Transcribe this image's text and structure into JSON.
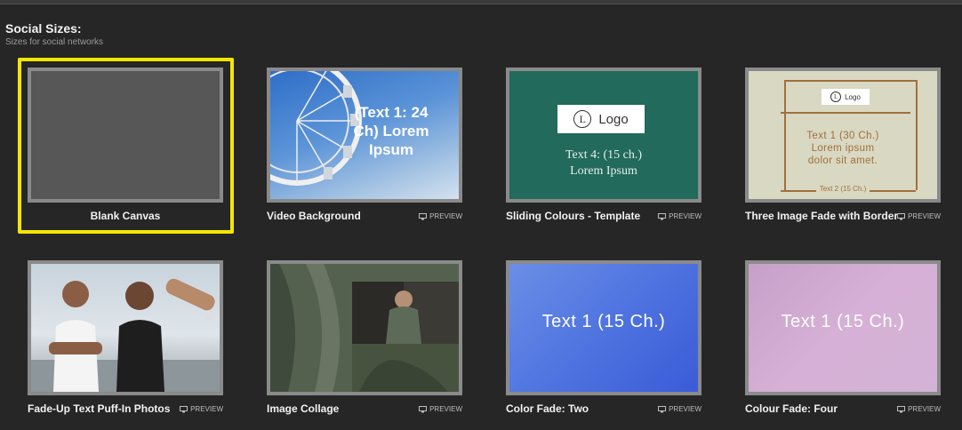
{
  "section": {
    "title": "Social Sizes:",
    "subtitle": "Sizes for social networks"
  },
  "preview_label": "PREVIEW",
  "selected_template": "Blank Canvas",
  "templates": [
    {
      "label": "Blank Canvas",
      "show_preview": false
    },
    {
      "label": "Video Background",
      "show_preview": true,
      "overlay_text": "(Text 1: 24 Ch) Lorem Ipsum"
    },
    {
      "label": "Sliding Colours - Template",
      "show_preview": true,
      "logo_text": "Logo",
      "logo_letter": "L",
      "body_line1": "Text 4: (15 ch.)",
      "body_line2": "Lorem Ipsum"
    },
    {
      "label": "Three Image Fade with Border",
      "show_preview": true,
      "logo_text": "Logo",
      "logo_letter": "L",
      "body_line1": "Text 1 (30 Ch.)",
      "body_line2": "Lorem ipsum",
      "body_line3": "dolor sit amet.",
      "foot": "Text 2 (15 Ch.)"
    },
    {
      "label": "Fade-Up Text Puff-In Photos",
      "show_preview": true
    },
    {
      "label": "Image Collage",
      "show_preview": true
    },
    {
      "label": "Color Fade: Two",
      "show_preview": true,
      "overlay_text": "Text 1 (15 Ch.)"
    },
    {
      "label": "Colour Fade: Four",
      "show_preview": true,
      "overlay_text": "Text 1 (15 Ch.)"
    }
  ],
  "colors": {
    "selection": "#f5e600",
    "background": "#262626"
  }
}
